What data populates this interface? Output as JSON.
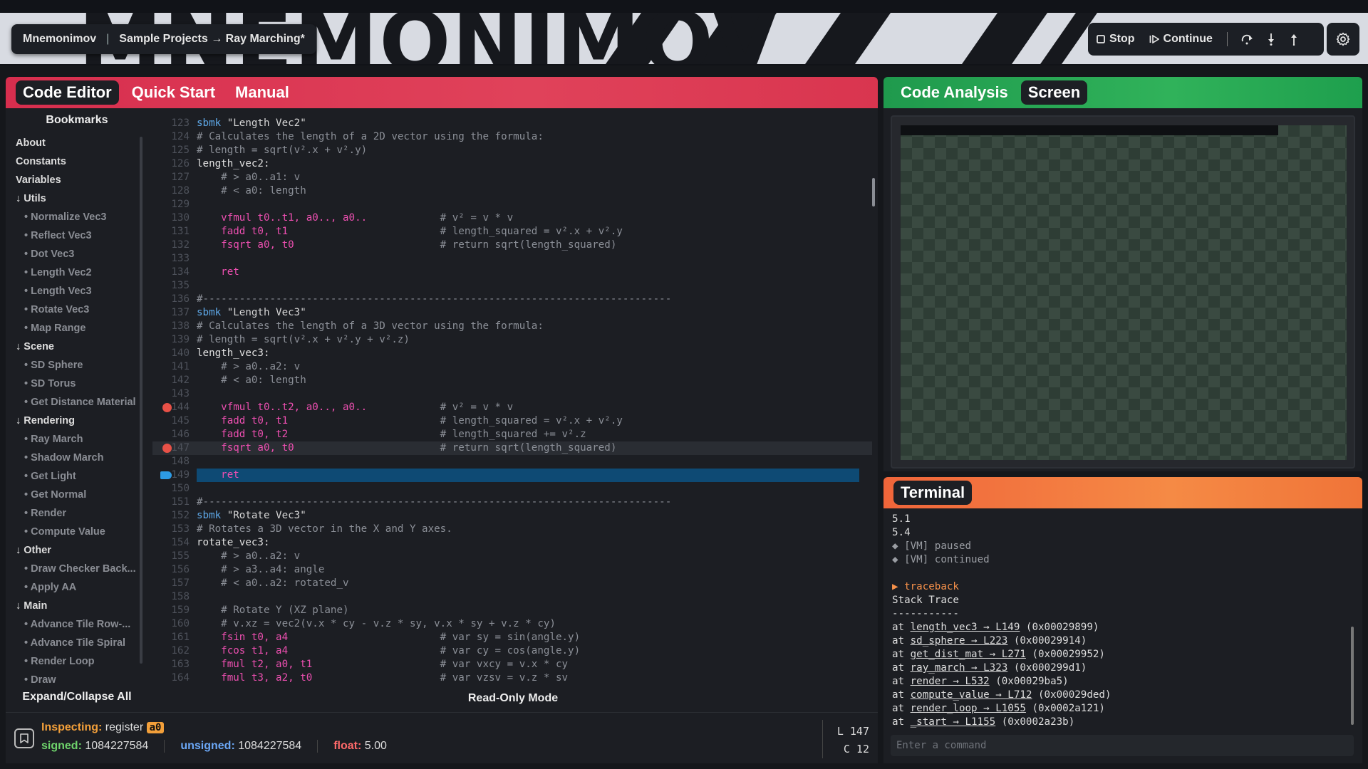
{
  "header": {
    "big_title": "MNEMONIMOV",
    "app_name": "Mnemonimov",
    "breadcrumb": "Sample Projects → Ray Marching*",
    "stop_label": "Stop",
    "continue_label": "Continue"
  },
  "editor": {
    "tabs": [
      "Code Editor",
      "Quick Start",
      "Manual"
    ],
    "active_tab": "Code Editor",
    "bookmarks_title": "Bookmarks",
    "bookmarks": [
      {
        "label": "About",
        "kind": "top"
      },
      {
        "label": "Constants",
        "kind": "top"
      },
      {
        "label": "Variables",
        "kind": "top"
      },
      {
        "label": "↓ Utils",
        "kind": "grp"
      },
      {
        "label": "• Normalize Vec3",
        "kind": "sub"
      },
      {
        "label": "• Reflect Vec3",
        "kind": "sub"
      },
      {
        "label": "• Dot Vec3",
        "kind": "sub"
      },
      {
        "label": "• Length Vec2",
        "kind": "sub"
      },
      {
        "label": "• Length Vec3",
        "kind": "sub"
      },
      {
        "label": "• Rotate Vec3",
        "kind": "sub"
      },
      {
        "label": "• Map Range",
        "kind": "sub"
      },
      {
        "label": "↓ Scene",
        "kind": "grp"
      },
      {
        "label": "• SD Sphere",
        "kind": "sub"
      },
      {
        "label": "• SD Torus",
        "kind": "sub"
      },
      {
        "label": "• Get Distance Material",
        "kind": "sub"
      },
      {
        "label": "↓ Rendering",
        "kind": "grp"
      },
      {
        "label": "• Ray March",
        "kind": "sub"
      },
      {
        "label": "• Shadow March",
        "kind": "sub"
      },
      {
        "label": "• Get Light",
        "kind": "sub"
      },
      {
        "label": "• Get Normal",
        "kind": "sub"
      },
      {
        "label": "• Render",
        "kind": "sub"
      },
      {
        "label": "• Compute Value",
        "kind": "sub"
      },
      {
        "label": "↓ Other",
        "kind": "grp"
      },
      {
        "label": "• Draw Checker Back...",
        "kind": "sub"
      },
      {
        "label": "• Apply AA",
        "kind": "sub"
      },
      {
        "label": "↓ Main",
        "kind": "grp"
      },
      {
        "label": "• Advance Tile Row-...",
        "kind": "sub"
      },
      {
        "label": "• Advance Tile Spiral",
        "kind": "sub"
      },
      {
        "label": "• Render Loop",
        "kind": "sub"
      },
      {
        "label": "• Draw",
        "kind": "sub"
      }
    ],
    "expand_label": "Expand/Collapse All",
    "readonly_label": "Read-Only Mode",
    "code_lines": [
      {
        "n": "123",
        "t": "sbmk \"Length Vec2\""
      },
      {
        "n": "124",
        "t": "# Calculates the length of a 2D vector using the formula:"
      },
      {
        "n": "125",
        "t": "# length = sqrt(v².x + v².y)"
      },
      {
        "n": "126",
        "t": "length_vec2:"
      },
      {
        "n": "127",
        "t": "    # > a0..a1: v"
      },
      {
        "n": "128",
        "t": "    # < a0: length"
      },
      {
        "n": "129",
        "t": ""
      },
      {
        "n": "130",
        "t": "    vfmul t0..t1, a0.., a0..            # v² = v * v"
      },
      {
        "n": "131",
        "t": "    fadd t0, t1                         # length_squared = v².x + v².y"
      },
      {
        "n": "132",
        "t": "    fsqrt a0, t0                        # return sqrt(length_squared)"
      },
      {
        "n": "133",
        "t": ""
      },
      {
        "n": "134",
        "t": "    ret"
      },
      {
        "n": "135",
        "t": ""
      },
      {
        "n": "136",
        "t": "#-----------------------------------------------------------------------------"
      },
      {
        "n": "137",
        "t": "sbmk \"Length Vec3\""
      },
      {
        "n": "138",
        "t": "# Calculates the length of a 3D vector using the formula:"
      },
      {
        "n": "139",
        "t": "# length = sqrt(v².x + v².y + v².z)"
      },
      {
        "n": "140",
        "t": "length_vec3:"
      },
      {
        "n": "141",
        "t": "    # > a0..a2: v"
      },
      {
        "n": "142",
        "t": "    # < a0: length"
      },
      {
        "n": "143",
        "t": ""
      },
      {
        "n": "144",
        "t": "    vfmul t0..t2, a0.., a0..            # v² = v * v"
      },
      {
        "n": "145",
        "t": "    fadd t0, t1                         # length_squared = v².x + v².y"
      },
      {
        "n": "146",
        "t": "    fadd t0, t2                         # length_squared += v².z"
      },
      {
        "n": "147",
        "t": "    fsqrt a0, t0                        # return sqrt(length_squared)"
      },
      {
        "n": "148",
        "t": ""
      },
      {
        "n": "149",
        "t": "    ret"
      },
      {
        "n": "150",
        "t": ""
      },
      {
        "n": "151",
        "t": "#-----------------------------------------------------------------------------"
      },
      {
        "n": "152",
        "t": "sbmk \"Rotate Vec3\""
      },
      {
        "n": "153",
        "t": "# Rotates a 3D vector in the X and Y axes."
      },
      {
        "n": "154",
        "t": "rotate_vec3:"
      },
      {
        "n": "155",
        "t": "    # > a0..a2: v"
      },
      {
        "n": "156",
        "t": "    # > a3..a4: angle"
      },
      {
        "n": "157",
        "t": "    # < a0..a2: rotated_v"
      },
      {
        "n": "158",
        "t": ""
      },
      {
        "n": "159",
        "t": "    # Rotate Y (XZ plane)"
      },
      {
        "n": "160",
        "t": "    # v.xz = vec2(v.x * cy - v.z * sy, v.x * sy + v.z * cy)"
      },
      {
        "n": "161",
        "t": "    fsin t0, a4                         # var sy = sin(angle.y)"
      },
      {
        "n": "162",
        "t": "    fcos t1, a4                         # var cy = cos(angle.y)"
      },
      {
        "n": "163",
        "t": "    fmul t2, a0, t1                     # var vxcy = v.x * cy"
      },
      {
        "n": "164",
        "t": "    fmul t3, a2, t0                     # var vzsv = v.z * sv"
      }
    ],
    "breakpoints": [
      "144",
      "147"
    ],
    "exec_line": "149",
    "cursor_line": "147"
  },
  "inspector": {
    "inspecting_label": "Inspecting:",
    "register_label": "register",
    "register": "a0",
    "signed_label": "signed:",
    "signed": "1084227584",
    "unsigned_label": "unsigned:",
    "unsigned": "1084227584",
    "float_label": "float:",
    "float": "5.00",
    "line_pos": "L 147",
    "col_pos": "C 12"
  },
  "analysis": {
    "tabs": [
      "Code Analysis",
      "Screen"
    ],
    "active_tab": "Screen"
  },
  "terminal": {
    "tab": "Terminal",
    "lines": [
      {
        "t": "5.1",
        "c": ""
      },
      {
        "t": "5.4",
        "c": ""
      },
      {
        "t": "◆ [VM] paused",
        "c": "dim"
      },
      {
        "t": "◆ [VM] continued",
        "c": "dim"
      },
      {
        "t": "",
        "c": ""
      },
      {
        "t": "▶ traceback",
        "c": "tb"
      },
      {
        "t": "Stack Trace",
        "c": ""
      },
      {
        "t": "-----------",
        "c": ""
      }
    ],
    "trace": [
      {
        "fn": "length_vec3 → L149",
        "addr": "(0x00029899)"
      },
      {
        "fn": "sd_sphere → L223",
        "addr": "(0x00029914)"
      },
      {
        "fn": "get_dist_mat → L271",
        "addr": "(0x00029952)"
      },
      {
        "fn": "ray_march → L323",
        "addr": "(0x000299d1)"
      },
      {
        "fn": "render → L532",
        "addr": "(0x00029ba5)"
      },
      {
        "fn": "compute_value → L712",
        "addr": "(0x00029ded)"
      },
      {
        "fn": "render_loop → L1055",
        "addr": "(0x0002a121)"
      },
      {
        "fn": "_start → L1155",
        "addr": "(0x0002a23b)"
      }
    ],
    "input_placeholder": "Enter a command"
  },
  "colors": {
    "editor_accent": "#d72e4e",
    "analysis_accent": "#30b25a",
    "terminal_accent": "#f58a45",
    "breakpoint": "#e85147",
    "exec_highlight": "#0e4a74"
  }
}
